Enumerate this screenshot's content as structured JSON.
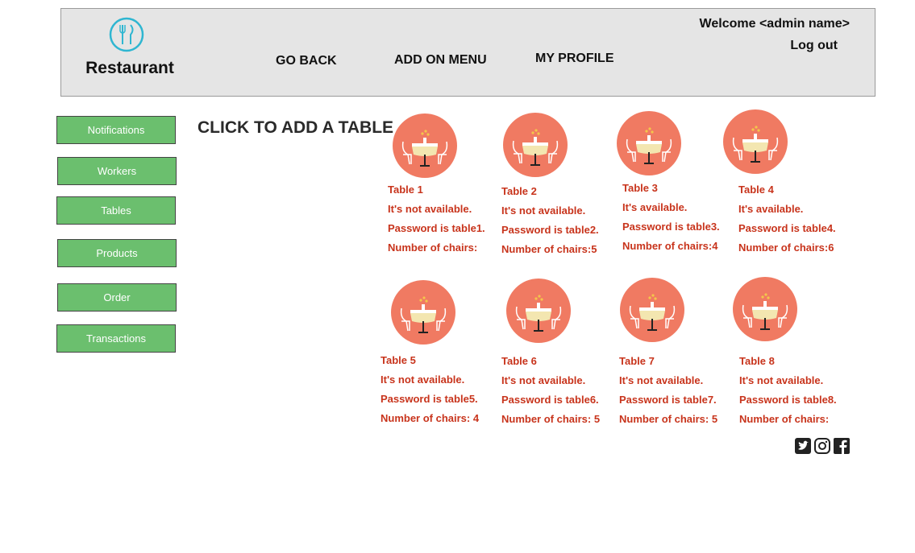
{
  "header": {
    "brand": "Restaurant",
    "nav": {
      "go_back": "GO BACK",
      "add_on_menu": "ADD ON MENU",
      "my_profile": "MY PROFILE"
    },
    "welcome": "Welcome <admin name>",
    "logout": "Log out"
  },
  "sidebar": {
    "items": [
      {
        "label": "Notifications"
      },
      {
        "label": "Workers"
      },
      {
        "label": "Tables"
      },
      {
        "label": "Products"
      },
      {
        "label": "Order"
      },
      {
        "label": "Transactions"
      }
    ]
  },
  "main": {
    "cta": "CLICK TO ADD A TABLE"
  },
  "tables": [
    {
      "name": "Table 1",
      "status": "It's not available.",
      "password": "Password is table1.",
      "chairs": "Number  of chairs:"
    },
    {
      "name": "Table 2",
      "status": "It's not available.",
      "password": "Password is table2.",
      "chairs": "Number of chairs:5"
    },
    {
      "name": "Table 3",
      "status": "It's available.",
      "password": "Password is table3.",
      "chairs": "Number of chairs:4"
    },
    {
      "name": "Table 4",
      "status": "It's available.",
      "password": "Password is table4.",
      "chairs": "Number of chairs:6"
    },
    {
      "name": "Table 5",
      "status": "It's not available.",
      "password": "Password is table5.",
      "chairs": "Number  of chairs: 4"
    },
    {
      "name": "Table 6",
      "status": "It's not available.",
      "password": "Password is table6.",
      "chairs": "Number  of chairs: 5"
    },
    {
      "name": "Table 7",
      "status": "It's not available.",
      "password": "Password is table7.",
      "chairs": "Number  of chairs: 5"
    },
    {
      "name": "Table 8",
      "status": "It's not available.",
      "password": "Password is table8.",
      "chairs": "Number  of chairs:"
    }
  ],
  "colors": {
    "accent_green": "#6bbf6e",
    "table_text": "#c8341c",
    "table_circle": "#f07a62",
    "logo_teal": "#2fb6d1"
  },
  "social": [
    "twitter-icon",
    "instagram-icon",
    "facebook-icon"
  ]
}
